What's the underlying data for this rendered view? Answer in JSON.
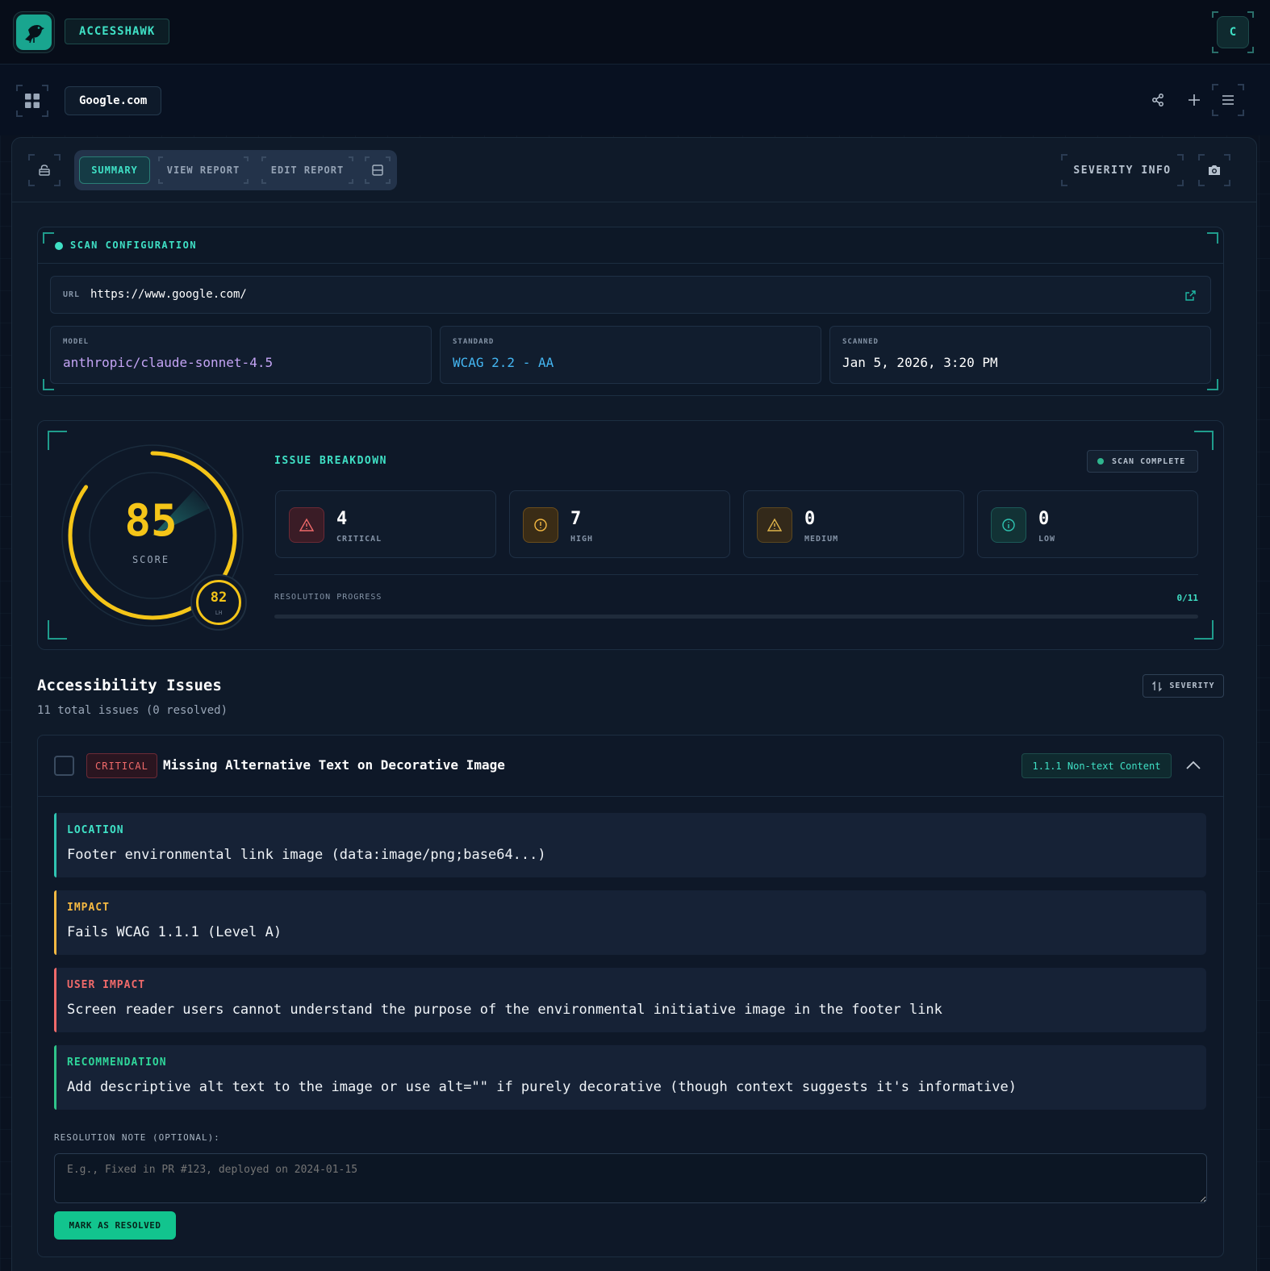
{
  "app": {
    "brand": "ACCESSHAWK",
    "avatar_initial": "C"
  },
  "site": {
    "name": "Google.com"
  },
  "tabs": [
    {
      "label": "SUMMARY",
      "active": true
    },
    {
      "label": "VIEW REPORT",
      "active": false
    },
    {
      "label": "EDIT REPORT",
      "active": false
    }
  ],
  "severity_info_label": "SEVERITY INFO",
  "scan_config": {
    "title": "SCAN CONFIGURATION",
    "url_label": "URL",
    "url": "https://www.google.com/",
    "model_label": "MODEL",
    "model": "anthropic/claude-sonnet-4.5",
    "standard_label": "STANDARD",
    "standard": "WCAG 2.2 - AA",
    "scanned_label": "SCANNED",
    "scanned": "Jan 5, 2026, 3:20 PM"
  },
  "score": {
    "value": "85",
    "label": "SCORE",
    "lh_value": "82",
    "lh_label": "LH",
    "fraction": 0.85
  },
  "breakdown": {
    "title": "ISSUE BREAKDOWN",
    "status": "SCAN COMPLETE",
    "items": [
      {
        "count": "4",
        "label": "CRITICAL"
      },
      {
        "count": "7",
        "label": "HIGH"
      },
      {
        "count": "0",
        "label": "MEDIUM"
      },
      {
        "count": "0",
        "label": "LOW"
      }
    ],
    "progress_label": "RESOLUTION PROGRESS",
    "progress_value": "0/11",
    "progress_fraction": 0
  },
  "issues": {
    "title": "Accessibility Issues",
    "subtitle": "11 total issues (0 resolved)",
    "sort_label": "SEVERITY",
    "first": {
      "severity": "CRITICAL",
      "title": "Missing Alternative Text on Decorative Image",
      "criterion": "1.1.1 Non-text Content",
      "location_label": "LOCATION",
      "location": "Footer environmental link image (data:image/png;base64...)",
      "impact_label": "IMPACT",
      "impact": "Fails WCAG 1.1.1 (Level A)",
      "user_impact_label": "USER IMPACT",
      "user_impact": "Screen reader users cannot understand the purpose of the environmental initiative image in the footer link",
      "recommendation_label": "RECOMMENDATION",
      "recommendation": "Add descriptive alt text to the image or use alt=\"\" if purely decorative (though context suggests it's informative)",
      "note_label": "RESOLUTION NOTE (OPTIONAL):",
      "note_placeholder": "E.g., Fixed in PR #123, deployed on 2024-01-15",
      "resolve_label": "MARK AS RESOLVED"
    }
  },
  "colors": {
    "accent": "#3fe0c5",
    "critical": "#f06a6a",
    "high": "#f5b942",
    "medium": "#e0b54a",
    "low": "#2fc4b2",
    "score": "#f5c518"
  },
  "icons": [
    "hawk-logo-icon",
    "grid-icon",
    "share-icon",
    "plus-icon",
    "menu-icon",
    "lock-icon",
    "layout-icon",
    "camera-icon",
    "external-link-icon",
    "warning-triangle-icon",
    "alert-circle-icon",
    "info-icon",
    "sort-icon",
    "chevron-up-icon"
  ]
}
